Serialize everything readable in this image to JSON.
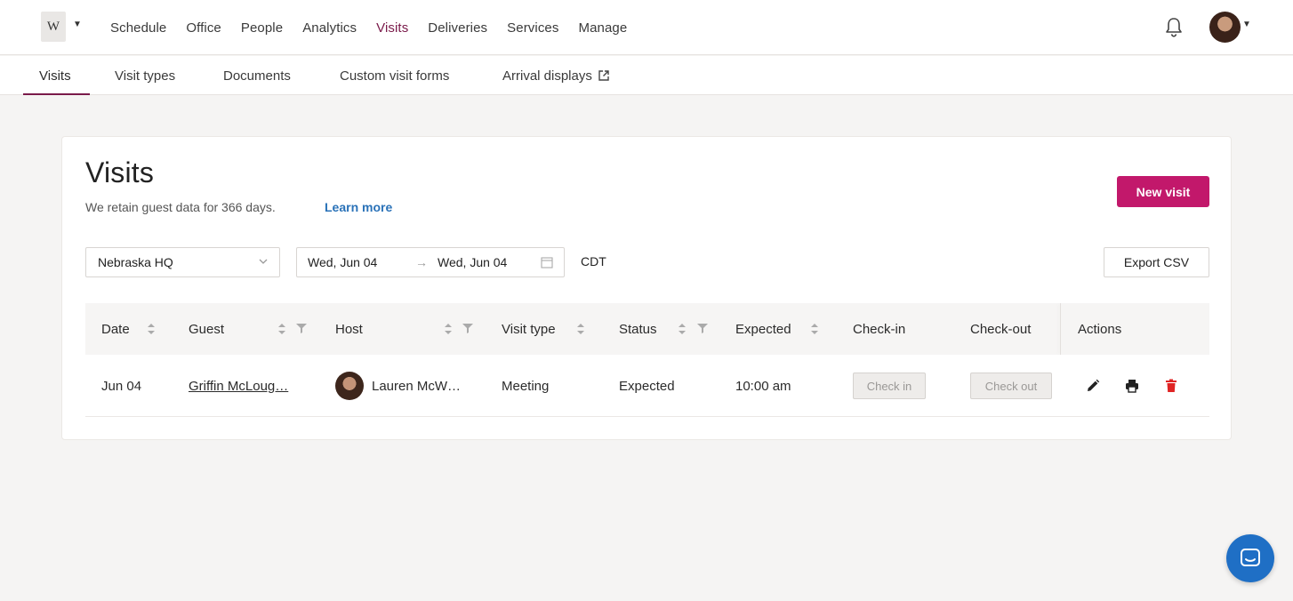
{
  "topnav": {
    "logo_text": "W",
    "items": [
      {
        "label": "Schedule"
      },
      {
        "label": "Office"
      },
      {
        "label": "People"
      },
      {
        "label": "Analytics"
      },
      {
        "label": "Visits"
      },
      {
        "label": "Deliveries"
      },
      {
        "label": "Services"
      },
      {
        "label": "Manage"
      }
    ],
    "active": "Visits",
    "accent_color": "#7a1a4a"
  },
  "subnav": {
    "tabs": [
      {
        "label": "Visits"
      },
      {
        "label": "Visit types"
      },
      {
        "label": "Documents"
      },
      {
        "label": "Custom visit forms"
      },
      {
        "label": "Arrival displays"
      }
    ],
    "active": "Visits"
  },
  "page": {
    "title": "Visits",
    "retain_text": "We retain guest data for 366 days.",
    "learn_more": "Learn more",
    "new_visit_label": "New visit",
    "primary_color": "#c2186b"
  },
  "filters": {
    "location": "Nebraska HQ",
    "date_from": "Wed, Jun 04",
    "date_arrow": "→",
    "date_to": "Wed, Jun 04",
    "timezone": "CDT",
    "export_label": "Export CSV"
  },
  "table": {
    "columns": {
      "date": "Date",
      "guest": "Guest",
      "host": "Host",
      "visit_type": "Visit type",
      "status": "Status",
      "expected": "Expected",
      "checkin": "Check-in",
      "checkout": "Check-out",
      "actions": "Actions"
    },
    "rows": [
      {
        "date": "Jun 04",
        "guest": "Griffin McLoug…",
        "host": "Lauren McW…",
        "visit_type": "Meeting",
        "status": "Expected",
        "expected": "10:00 am",
        "checkin_label": "Check in",
        "checkout_label": "Check out"
      }
    ],
    "delete_color": "#e02424"
  }
}
